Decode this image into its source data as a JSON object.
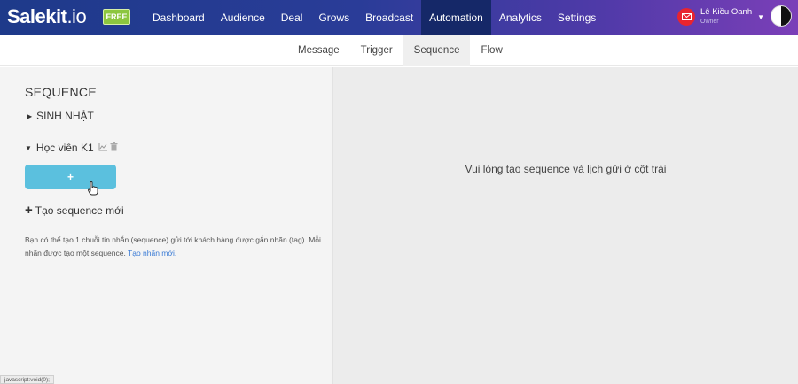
{
  "brand": {
    "logo_main": "Salekit",
    "logo_suffix": ".io",
    "plan_badge": "FREE"
  },
  "nav": {
    "items": [
      {
        "label": "Dashboard",
        "active": false
      },
      {
        "label": "Audience",
        "active": false
      },
      {
        "label": "Deal",
        "active": false
      },
      {
        "label": "Grows",
        "active": false
      },
      {
        "label": "Broadcast",
        "active": false
      },
      {
        "label": "Automation",
        "active": true
      },
      {
        "label": "Analytics",
        "active": false
      },
      {
        "label": "Settings",
        "active": false
      }
    ]
  },
  "user": {
    "name": "Lê Kiều Oanh",
    "role": "Owner",
    "icon": "mail-icon"
  },
  "subnav": {
    "tabs": [
      {
        "label": "Message",
        "active": false
      },
      {
        "label": "Trigger",
        "active": false
      },
      {
        "label": "Sequence",
        "active": true
      },
      {
        "label": "Flow",
        "active": false
      }
    ]
  },
  "sidebar": {
    "title": "SEQUENCE",
    "groups": [
      {
        "label": "SINH NHẬT",
        "expanded": false
      },
      {
        "label": "Học viên K1",
        "expanded": true
      }
    ],
    "add_button_label": "+",
    "create_label": "Tạo sequence mới",
    "help_text": "Bạn có thể tạo 1 chuỗi tin nhắn (sequence) gửi tới khách hàng được gắn nhãn (tag). Mỗi nhãn được tạo một sequence.",
    "help_link": "Tạo nhãn mới."
  },
  "main": {
    "empty_message": "Vui lòng tạo sequence và lịch gửi ở cột trái"
  },
  "statusbar": {
    "text": "javascript:void(0);"
  },
  "colors": {
    "nav_start": "#1e3a8a",
    "nav_end": "#7b3fb8",
    "active_nav": "#152868",
    "badge": "#8cc63f",
    "add_button": "#5bc0de",
    "link": "#3a7bd5"
  }
}
